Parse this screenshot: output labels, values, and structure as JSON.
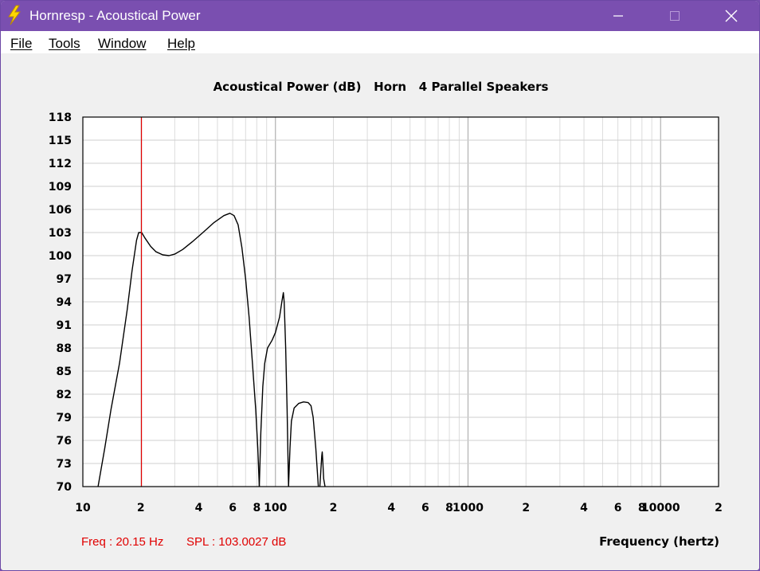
{
  "window": {
    "title": "Hornresp - Acoustical Power",
    "icon": "lightning-bolt-icon",
    "controls": [
      "minimize-icon",
      "maximize-icon",
      "close-icon"
    ]
  },
  "menu": {
    "items": [
      {
        "label": "File"
      },
      {
        "label": "Tools"
      },
      {
        "label": "Window"
      },
      {
        "label": "Help"
      }
    ]
  },
  "readout": {
    "freq": "Freq : 20.15 Hz",
    "spl": "SPL : 103.0027 dB",
    "cursor_freq_hz": 20.15,
    "color": "#e00000"
  },
  "chart_data": {
    "type": "line",
    "title": "Acoustical Power (dB)   Horn   4 Parallel Speakers",
    "xlabel": "Frequency (hertz)",
    "ylabel": "",
    "xscale": "log",
    "xlim": [
      10,
      20000
    ],
    "ylim": [
      70,
      118
    ],
    "grid": true,
    "y_ticks": [
      "118",
      "115",
      "112",
      "109",
      "106",
      "103",
      "100",
      "97",
      "94",
      "91",
      "88",
      "85",
      "82",
      "79",
      "76",
      "73",
      "70"
    ],
    "x_ticks": [
      {
        "value": 10,
        "label": "10"
      },
      {
        "value": 20,
        "label": "2"
      },
      {
        "value": 40,
        "label": "4"
      },
      {
        "value": 60,
        "label": "6"
      },
      {
        "value": 80,
        "label": "8"
      },
      {
        "value": 100,
        "label": "100"
      },
      {
        "value": 200,
        "label": "2"
      },
      {
        "value": 400,
        "label": "4"
      },
      {
        "value": 600,
        "label": "6"
      },
      {
        "value": 800,
        "label": "8"
      },
      {
        "value": 1000,
        "label": "1000"
      },
      {
        "value": 2000,
        "label": "2"
      },
      {
        "value": 4000,
        "label": "4"
      },
      {
        "value": 6000,
        "label": "6"
      },
      {
        "value": 8000,
        "label": "8"
      },
      {
        "value": 10000,
        "label": "10000"
      },
      {
        "value": 20000,
        "label": "2"
      }
    ],
    "line_color": "#000000",
    "series": [
      {
        "segments": [
          [
            [
              12,
              70
            ],
            [
              13,
              75
            ],
            [
              14,
              80
            ],
            [
              15.5,
              86
            ],
            [
              17,
              93
            ],
            [
              18,
              98
            ],
            [
              19,
              102
            ],
            [
              19.5,
              103
            ],
            [
              20.2,
              103
            ],
            [
              21,
              102.3
            ],
            [
              22.5,
              101.2
            ],
            [
              24,
              100.5
            ],
            [
              26,
              100.1
            ],
            [
              28,
              100
            ],
            [
              30,
              100.2
            ],
            [
              33,
              100.8
            ],
            [
              37,
              101.8
            ],
            [
              42,
              103
            ],
            [
              48,
              104.3
            ],
            [
              54,
              105.2
            ],
            [
              58,
              105.5
            ],
            [
              61,
              105.2
            ],
            [
              64,
              104
            ],
            [
              67,
              101
            ],
            [
              70,
              97
            ],
            [
              73,
              92
            ],
            [
              76,
              86
            ],
            [
              79,
              80
            ],
            [
              81,
              75
            ],
            [
              82.5,
              70
            ]
          ],
          [
            [
              82.5,
              70
            ],
            [
              84,
              77
            ],
            [
              86,
              83
            ],
            [
              88,
              86
            ],
            [
              91,
              88
            ],
            [
              96,
              89
            ],
            [
              100,
              90
            ],
            [
              105,
              92
            ],
            [
              108,
              94
            ],
            [
              110,
              95.2
            ],
            [
              111,
              94
            ],
            [
              113,
              88
            ],
            [
              115,
              80
            ],
            [
              116.5,
              72
            ],
            [
              117,
              70
            ]
          ],
          [
            [
              117,
              70
            ],
            [
              119,
              75
            ],
            [
              121,
              78.5
            ],
            [
              125,
              80.2
            ],
            [
              132,
              80.8
            ],
            [
              140,
              81
            ],
            [
              148,
              80.9
            ],
            [
              153,
              80.5
            ],
            [
              157,
              79
            ],
            [
              162,
              75
            ],
            [
              167,
              70
            ]
          ],
          [
            [
              170,
              70
            ],
            [
              172,
              72
            ],
            [
              174,
              74
            ],
            [
              175,
              74.5
            ],
            [
              176,
              73.5
            ],
            [
              178,
              71
            ],
            [
              181,
              70
            ]
          ]
        ]
      }
    ]
  }
}
